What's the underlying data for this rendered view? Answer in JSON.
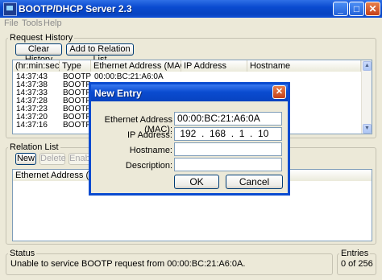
{
  "window": {
    "title": "BOOTP/DHCP Server 2.3",
    "minimize": "_",
    "maximize": "□",
    "close": "✕"
  },
  "menu": [
    "File",
    "Tools",
    "Help"
  ],
  "request_history": {
    "group_label": "Request History",
    "clear_label": "Clear History",
    "add_label": "Add to Relation List",
    "columns": [
      "(hr:min:sec)",
      "Type",
      "Ethernet Address (MAC)",
      "IP Address",
      "Hostname"
    ],
    "rows": [
      {
        "time": "14:37:43",
        "type": "BOOTP",
        "mac": "00:00:BC:21:A6:0A"
      },
      {
        "time": "14:37:38",
        "type": "BOOTP",
        "mac": ""
      },
      {
        "time": "14:37:33",
        "type": "BOOTP",
        "mac": ""
      },
      {
        "time": "14:37:28",
        "type": "BOOTP",
        "mac": ""
      },
      {
        "time": "14:37:23",
        "type": "BOOTP",
        "mac": ""
      },
      {
        "time": "14:37:20",
        "type": "BOOTP",
        "mac": ""
      },
      {
        "time": "14:37:16",
        "type": "BOOTP",
        "mac": ""
      }
    ]
  },
  "relation_list": {
    "group_label": "Relation List",
    "new_label": "New",
    "delete_label": "Delete",
    "enable_label": "Enable",
    "columns": [
      "Ethernet Address (MAC)"
    ]
  },
  "status": {
    "label": "Status",
    "text": "Unable to service BOOTP request from 00:00:BC:21:A6:0A."
  },
  "entries": {
    "label": "Entries",
    "text": "0 of 256"
  },
  "dialog": {
    "title": "New Entry",
    "close": "✕",
    "mac_label": "Ethernet Address (MAC):",
    "mac_value": "00:00:BC:21:A6:0A",
    "ip_label": "IP Address:",
    "ip_value": " 192  .  168  .  1  .  10",
    "hostname_label": "Hostname:",
    "hostname_value": "",
    "description_label": "Description:",
    "description_value": "",
    "ok_label": "OK",
    "cancel_label": "Cancel"
  }
}
